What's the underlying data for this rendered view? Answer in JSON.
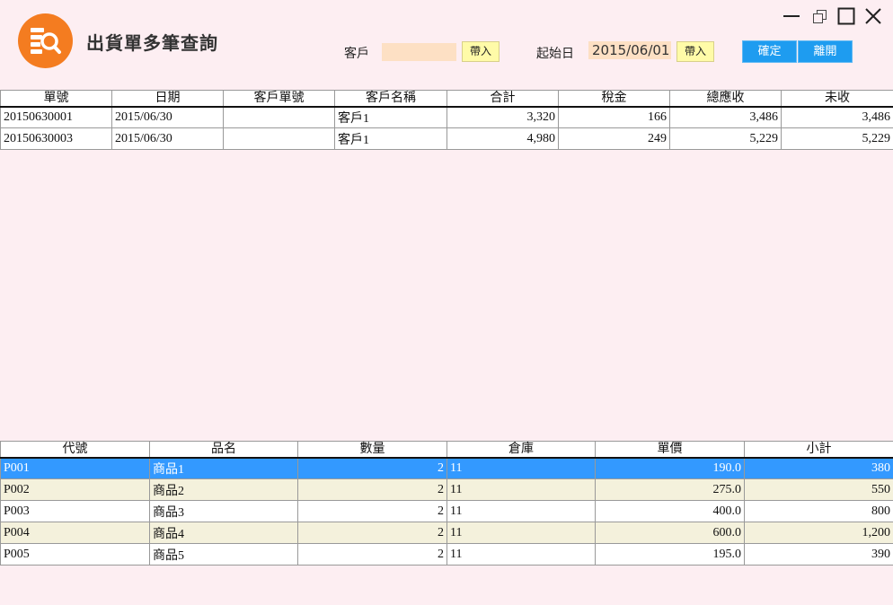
{
  "window": {
    "title": "出貨單多筆查詢"
  },
  "filters": {
    "customer_label": "客戶",
    "customer_value": "",
    "customer_import": "帶入",
    "start_date_label": "起始日",
    "start_date_value": "2015/06/01",
    "start_date_import": "帶入",
    "confirm": "確定",
    "exit": "離開"
  },
  "orders": {
    "columns": [
      "單號",
      "日期",
      "客戶單號",
      "客戶名稱",
      "合計",
      "稅金",
      "總應收",
      "未收"
    ],
    "rows": [
      [
        "20150630001",
        "2015/06/30",
        "",
        "客戶1",
        "3,320",
        "166",
        "3,486",
        "3,486"
      ],
      [
        "20150630003",
        "2015/06/30",
        "",
        "客戶1",
        "4,980",
        "249",
        "5,229",
        "5,229"
      ]
    ]
  },
  "details": {
    "columns": [
      "代號",
      "品名",
      "數量",
      "倉庫",
      "單價",
      "小計"
    ],
    "rows": [
      [
        "P001",
        "商品1",
        "2",
        "11",
        "190.0",
        "380"
      ],
      [
        "P002",
        "商品2",
        "2",
        "11",
        "275.0",
        "550"
      ],
      [
        "P003",
        "商品3",
        "2",
        "11",
        "400.0",
        "800"
      ],
      [
        "P004",
        "商品4",
        "2",
        "11",
        "600.0",
        "1,200"
      ],
      [
        "P005",
        "商品5",
        "2",
        "11",
        "195.0",
        "390"
      ]
    ],
    "selected_row": 0
  },
  "colors": {
    "background": "#fdeef2",
    "accent": "#f47c20",
    "button_blue": "#1e9cf0",
    "selection": "#3399ff"
  }
}
